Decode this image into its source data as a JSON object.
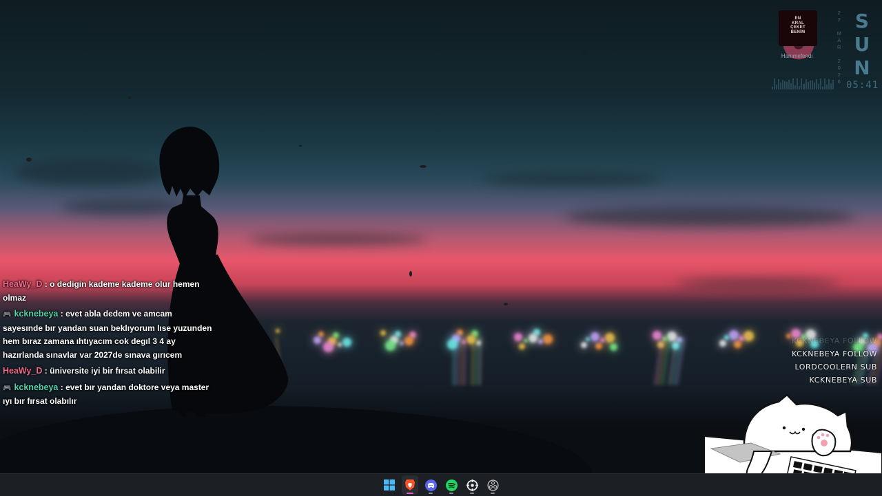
{
  "chat": {
    "messages": [
      {
        "user": "HeaWy_D",
        "user_color": "#ee6a8a",
        "has_badge": false,
        "text": "o dedigin kademe kademe olur hemen olmaz"
      },
      {
        "user": "kcknebeya",
        "user_color": "#4fd3a8",
        "has_badge": true,
        "text": "evet abla dedem ve amcam sayesınde bır yandan suan beklıyorum lıse yuzunden hem bıraz zamana ıhtıyacım cok degıl 3 4 ay hazırlanda sınavlar var 2027de sınava gırıcem"
      },
      {
        "user": "HeaWy_D",
        "user_color": "#ee6a8a",
        "has_badge": false,
        "text": "üniversite iyi bir fırsat olabilir"
      },
      {
        "user": "kcknebeya",
        "user_color": "#4fd3a8",
        "has_badge": true,
        "text": "evet bır yandan doktore veya master ıyı bır fırsat olabılır"
      }
    ],
    "separator": " : "
  },
  "music_widget": {
    "album_text": [
      "EN",
      "KRAL",
      "ÇEKET",
      "BENİM"
    ],
    "artist": "Hanımefendi"
  },
  "clock_widget": {
    "date_letters": [
      "2",
      "2",
      "",
      "M",
      "A",
      "R",
      "",
      "2",
      "0",
      "2",
      "6"
    ],
    "day_letters": [
      "S",
      "U",
      "N"
    ],
    "time": "05:41"
  },
  "alerts": [
    {
      "text": "KCKNEBEYA FOLLOW",
      "faded": true
    },
    {
      "text": "KCKNEBEYA FOLLOW",
      "faded": false
    },
    {
      "text": "LORDCOOLERN SUB",
      "faded": false
    },
    {
      "text": "KCKNEBEYA SUB",
      "faded": false
    }
  ],
  "taskbar": {
    "items": [
      {
        "name": "windows-start-icon",
        "active": false,
        "indicator": false
      },
      {
        "name": "brave-browser-icon",
        "active": true,
        "indicator": true
      },
      {
        "name": "discord-icon",
        "active": false,
        "indicator": true
      },
      {
        "name": "spotify-icon",
        "active": false,
        "indicator": true
      },
      {
        "name": "steam-icon",
        "active": false,
        "indicator": true
      },
      {
        "name": "obs-icon",
        "active": false,
        "indicator": true
      }
    ],
    "colors": {
      "windows": "#4cb8f5",
      "brave": "#fb542b",
      "discord": "#5865f2",
      "spotify": "#1ed760",
      "steam": "#e8e8e8",
      "obs": "#bcbcbc"
    }
  }
}
